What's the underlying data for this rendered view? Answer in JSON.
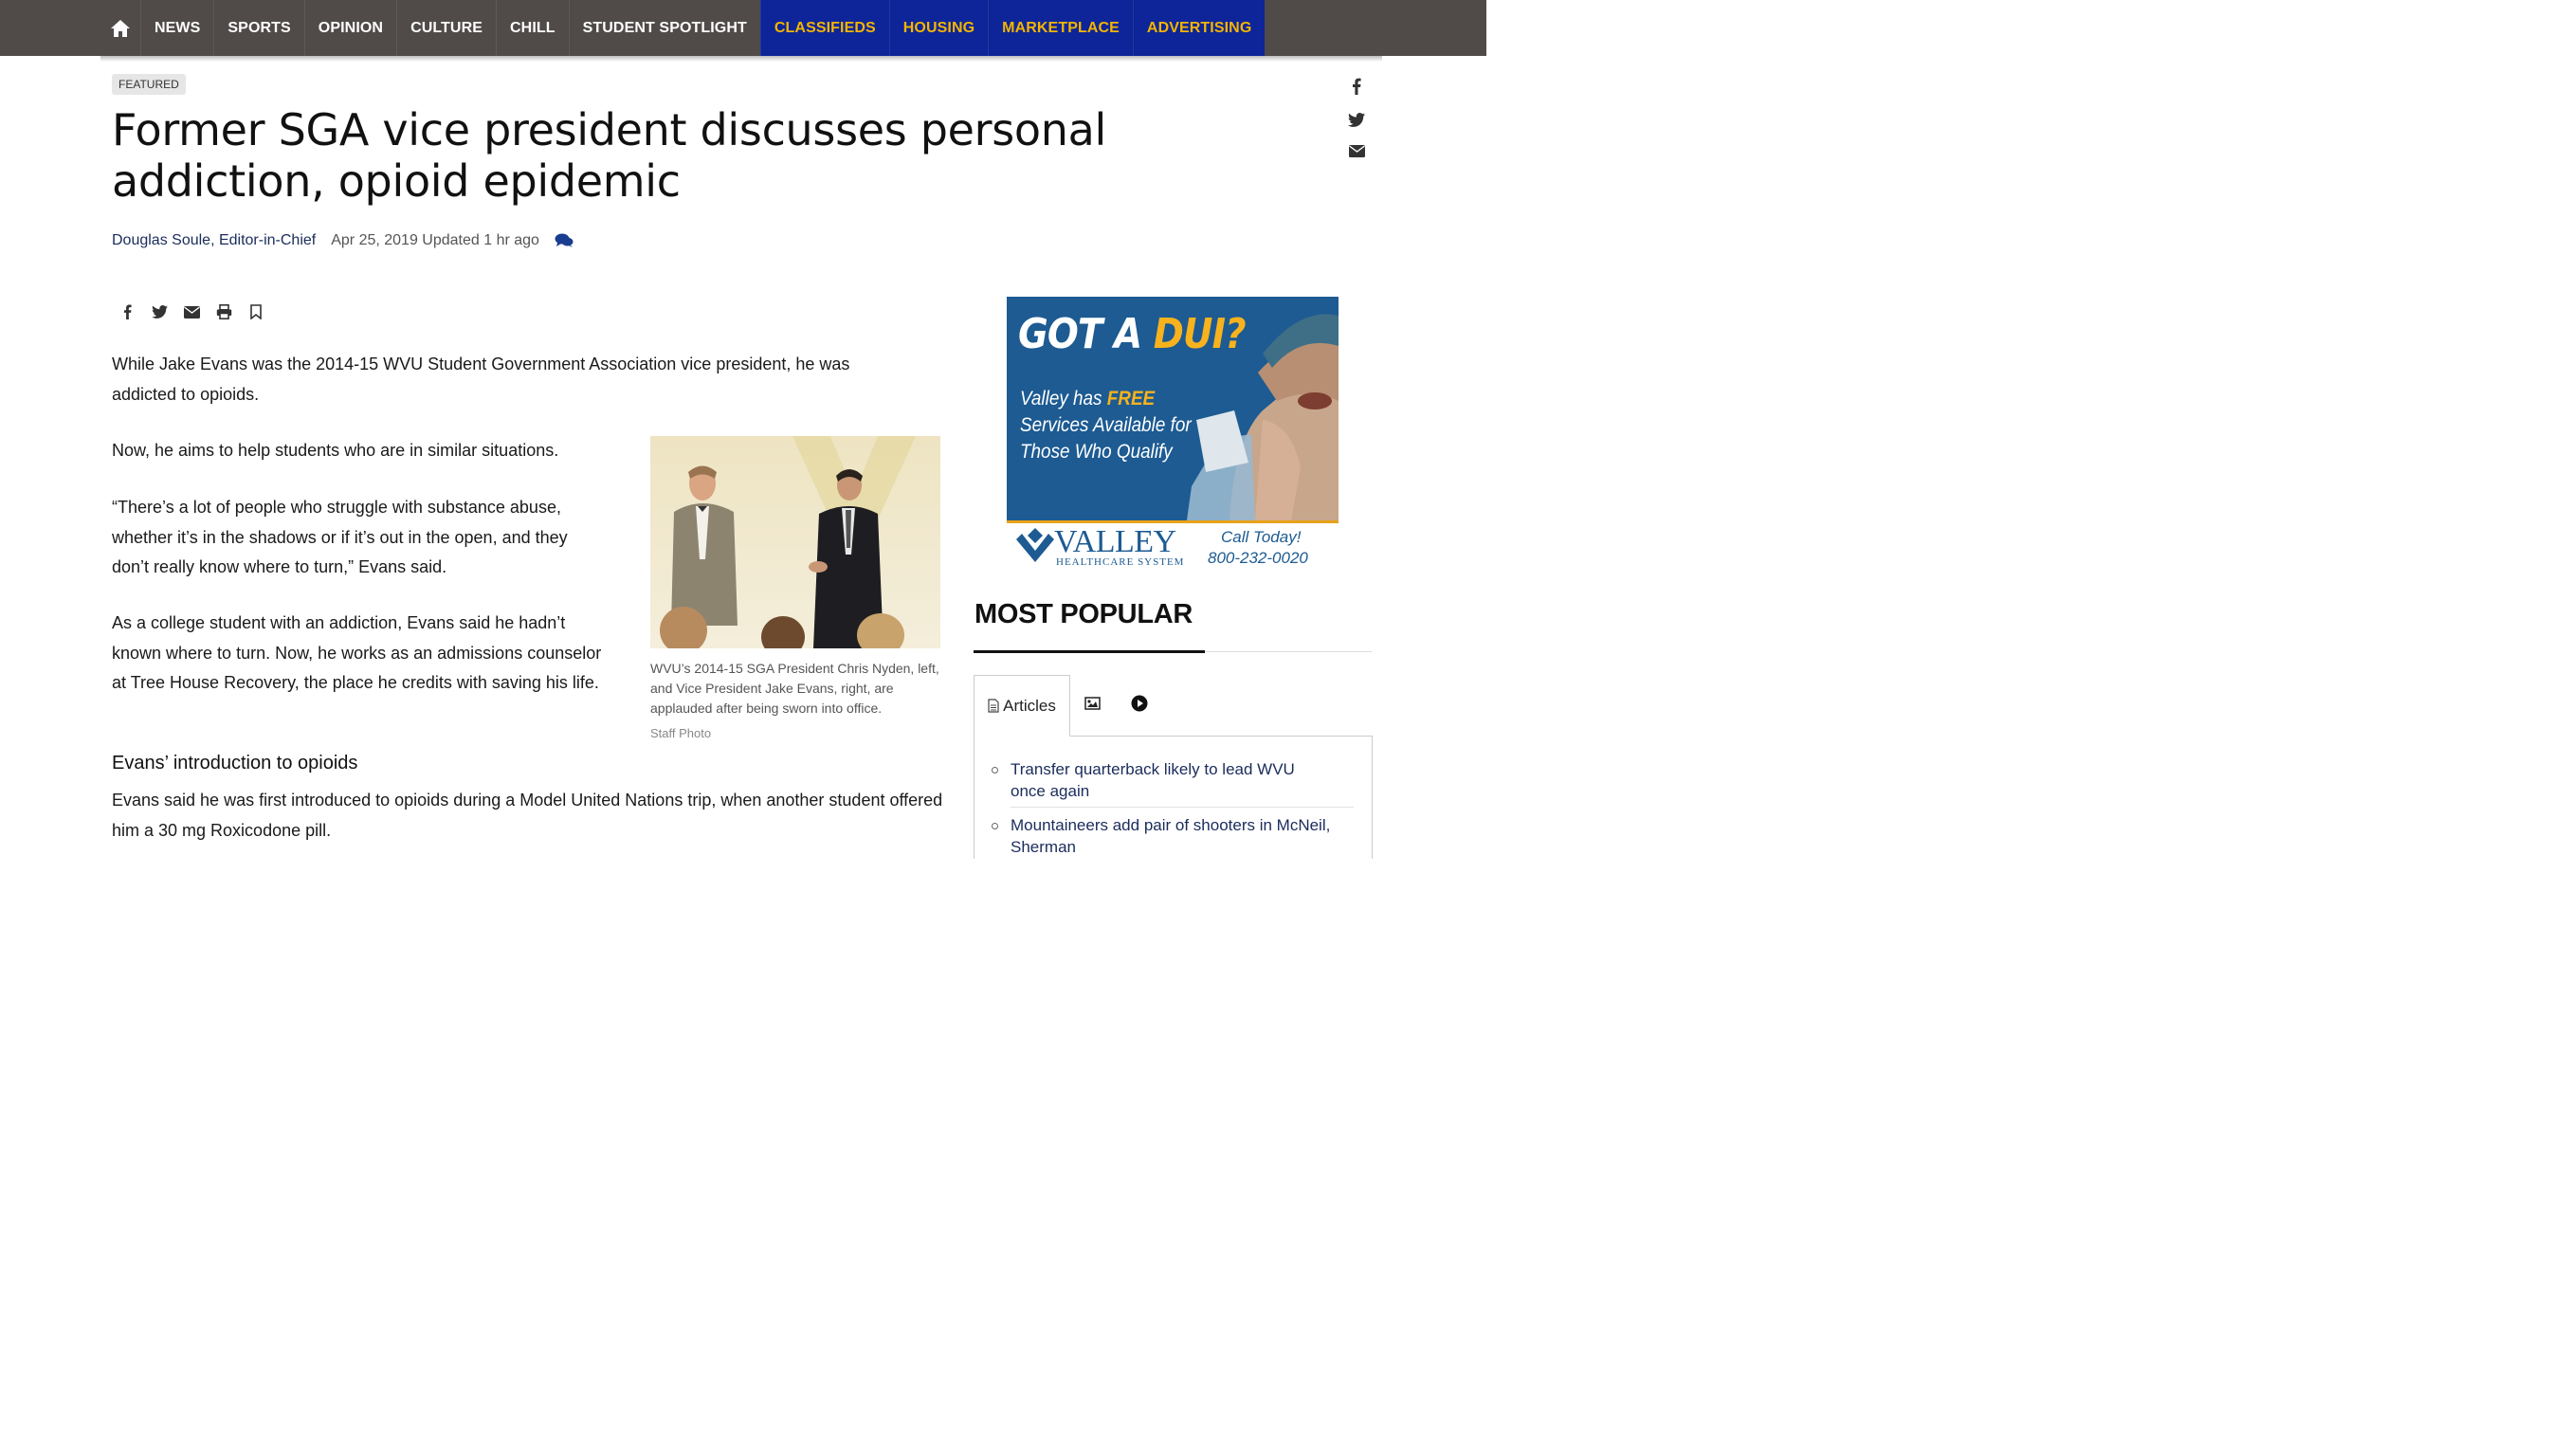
{
  "nav": {
    "items": [
      "NEWS",
      "SPORTS",
      "OPINION",
      "CULTURE",
      "CHILL",
      "STUDENT SPOTLIGHT"
    ],
    "special_items": [
      "CLASSIFIEDS",
      "HOUSING",
      "MARKETPLACE",
      "ADVERTISING"
    ],
    "home_icon": "home-icon",
    "bg_color": "#504b49",
    "special_bg_color": "#0d2598",
    "special_text_color": "#f4b400"
  },
  "article": {
    "tag": "FEATURED",
    "headline": "Former SGA vice president discusses personal addiction, opioid epidemic",
    "author": "Douglas Soule, Editor-in-Chief",
    "date": "Apr 25, 2019 Updated 1 hr ago",
    "paragraphs": [
      "While Jake Evans was the 2014-15 WVU Student Government Association vice president, he was addicted to opioids.",
      "Now, he aims to help students who are in similar situations.",
      "“There’s a lot of people who struggle with substance abuse, whether it’s in the shadows or if it’s out in the open, and they don’t really know where to turn,” Evans said.",
      "As a college student with an addiction, Evans said he hadn’t known where to turn. Now, he works as an admissions counselor at Tree House Recovery, the place he credits with saving his life."
    ],
    "subhead": "Evans’ introduction to opioids",
    "paragraph_after_subhead": "Evans said he was first introduced to opioids during a Model United Nations trip, when another student offered him a 30 mg Roxicodone pill.",
    "photo_caption": "WVU’s 2014-15 SGA President Chris Nyden, left, and Vice President Jake Evans, right, are applauded after being sworn into office.",
    "photo_credit": "Staff Photo"
  },
  "ad": {
    "headline_part1": "GOT A ",
    "headline_part2": "DUI?",
    "body_prefix": "Valley has ",
    "body_free": "FREE",
    "body_suffix": " Services Available for Those Who Qualify",
    "brand": "VALLEY",
    "brand_sub": "HEALTHCARE SYSTEM",
    "call_line1": "Call Today!",
    "call_line2": "800-232-0020"
  },
  "most_popular": {
    "title": "MOST POPULAR",
    "tabs": [
      "Articles"
    ],
    "items": [
      "Transfer quarterback likely to lead WVU once again",
      "Mountaineers add pair of shooters in McNeil, Sherman"
    ]
  }
}
